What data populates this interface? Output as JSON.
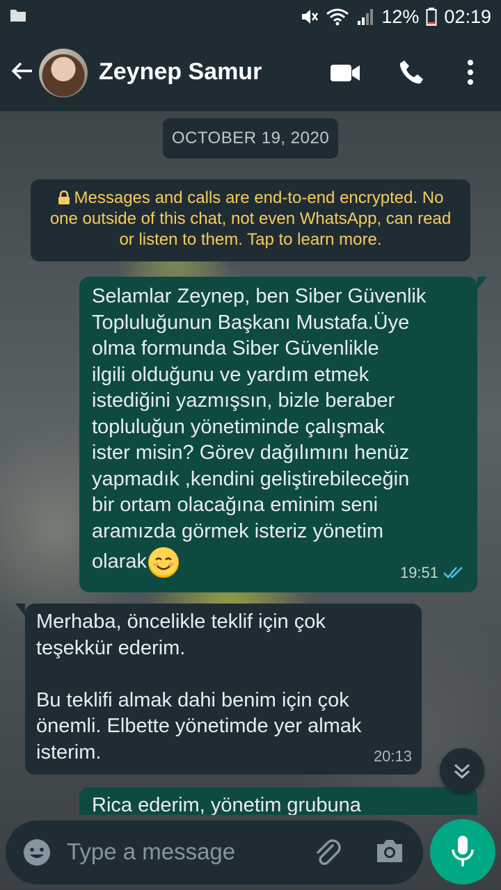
{
  "status_bar": {
    "battery_percent": "12%",
    "time": "02:19"
  },
  "header": {
    "contact_name": "Zeynep Samur"
  },
  "chat": {
    "date_chip": "OCTOBER 19, 2020",
    "encryption_notice": "Messages and calls are end-to-end encrypted. No one outside of this chat, not even WhatsApp, can read or listen to them. Tap to learn more.",
    "messages": [
      {
        "direction": "outgoing",
        "lines": [
          "Selamlar Zeynep, ben Siber Güvenlik",
          "Topluluğunun Başkanı Mustafa.Üye",
          "olma formunda Siber Güvenlikle",
          "ilgili olduğunu ve yardım etmek",
          "istediğini yazmışsın, bizle beraber",
          "topluluğun yönetiminde çalışmak",
          "ister misin? Görev dağılımını henüz",
          "yapmadık ,kendini geliştirebileceğin",
          "bir ortam olacağına eminim seni",
          "aramızda görmek isteriz yönetim",
          "olarak"
        ],
        "time": "19:51"
      },
      {
        "direction": "incoming",
        "lines": [
          "Merhaba, öncelikle teklif için çok",
          "teşekkür ederim.",
          "",
          "Bu teklifi almak dahi benim için çok",
          "önemli. Elbette yönetimde yer almak",
          "isterim."
        ],
        "time": "20:13"
      },
      {
        "direction": "outgoing",
        "lines": [
          "Rica ederim, yönetim grubuna"
        ]
      }
    ]
  },
  "compose": {
    "placeholder": "Type a message"
  }
}
